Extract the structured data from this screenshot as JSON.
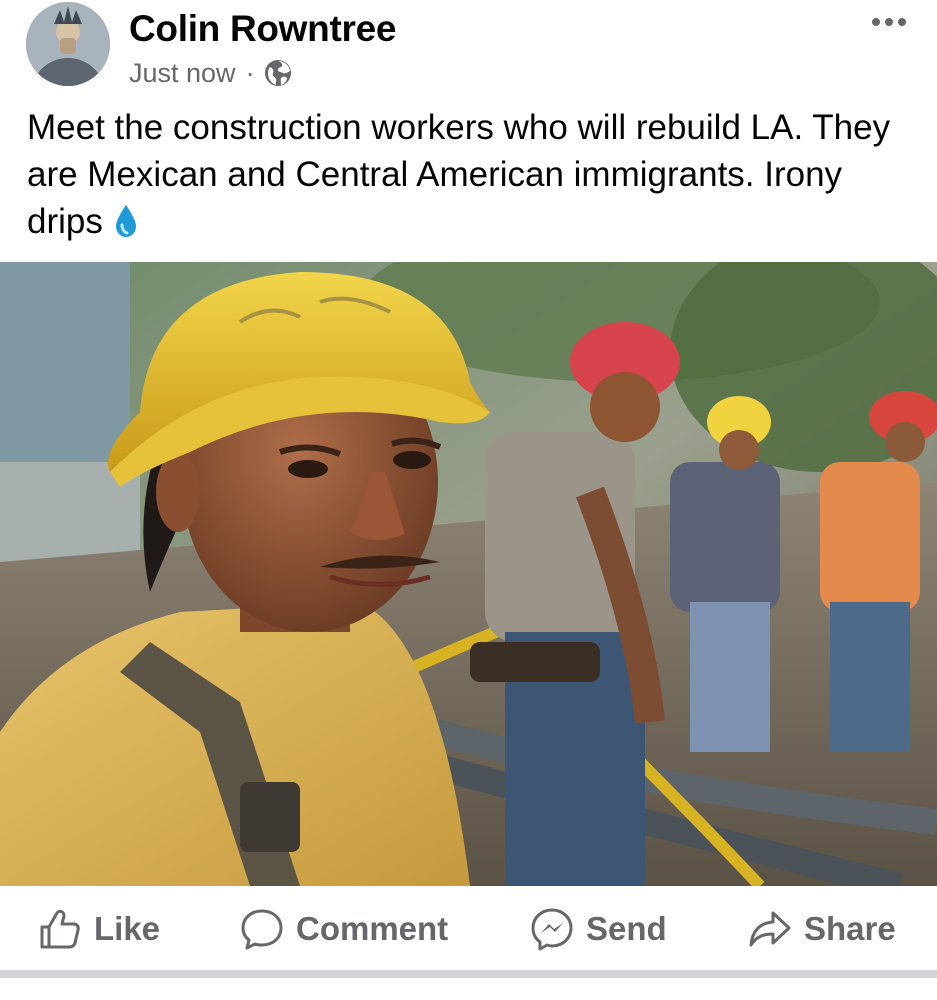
{
  "post": {
    "author_name": "Colin Rowntree",
    "timestamp": "Just now",
    "separator": "·",
    "audience_icon": "globe-icon",
    "more_icon": "more-dots-icon",
    "caption": "Meet the construction workers who will rebuild LA. They are Mexican and Central American immigrants. Irony drips",
    "caption_emoji": "droplet-icon",
    "image_description_icon": "photo"
  },
  "actions": [
    {
      "label": "Like",
      "icon": "thumbs-up-icon"
    },
    {
      "label": "Comment",
      "icon": "comment-bubble-icon"
    },
    {
      "label": "Send",
      "icon": "messenger-icon"
    },
    {
      "label": "Share",
      "icon": "share-arrow-icon"
    }
  ],
  "colors": {
    "text_primary": "#050505",
    "text_secondary": "#65676b",
    "divider": "#d2d4d8",
    "emoji_drop": "#1e9bd7"
  }
}
